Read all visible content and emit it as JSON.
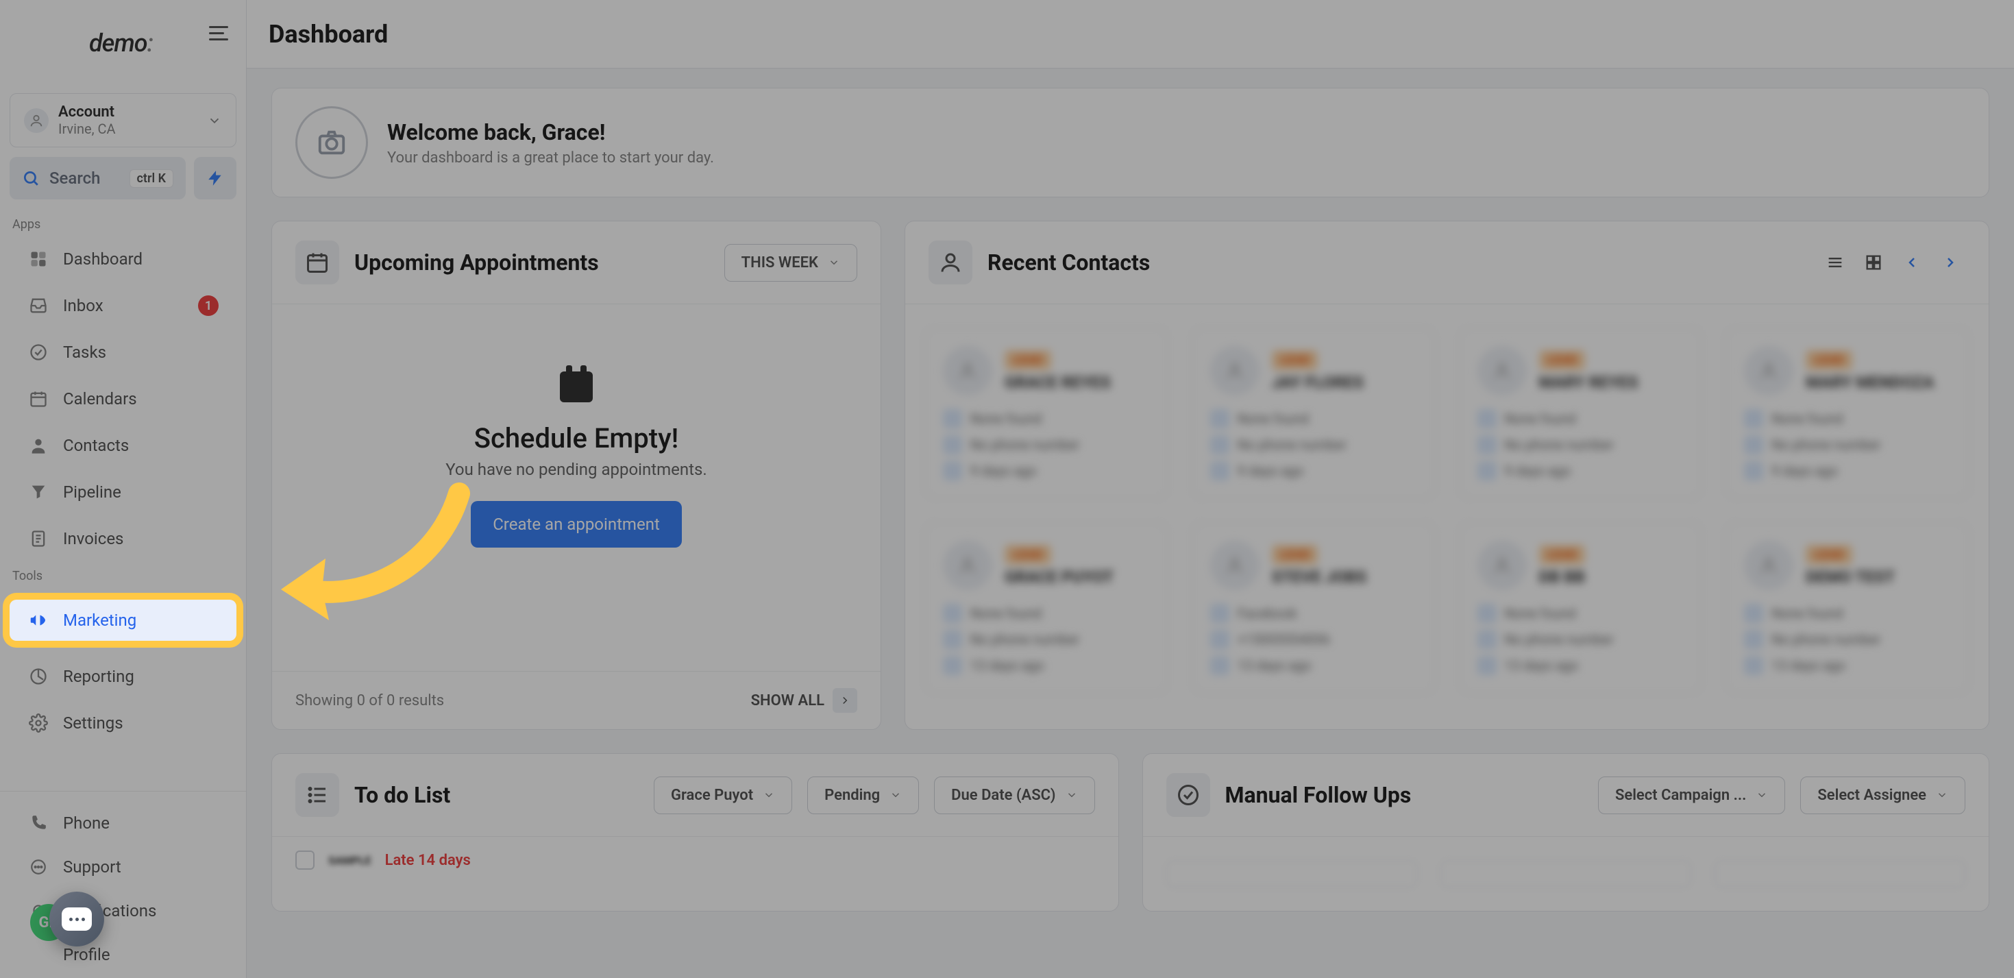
{
  "logo": "demo",
  "account": {
    "title": "Account",
    "sub": "Irvine, CA"
  },
  "search": {
    "placeholder": "Search",
    "kbd": "ctrl K"
  },
  "sections": {
    "apps": "Apps",
    "tools": "Tools"
  },
  "nav": {
    "dashboard": "Dashboard",
    "inbox": "Inbox",
    "inbox_badge": "1",
    "tasks": "Tasks",
    "calendars": "Calendars",
    "contacts": "Contacts",
    "pipeline": "Pipeline",
    "invoices": "Invoices",
    "marketing": "Marketing",
    "reporting": "Reporting",
    "settings": "Settings",
    "phone": "Phone",
    "support": "Support",
    "notifications": "Notifications",
    "profile": "Profile"
  },
  "profile_initials": "GR",
  "topbar": {
    "title": "Dashboard"
  },
  "welcome": {
    "title": "Welcome back, Grace!",
    "sub": "Your dashboard is a great place to start your day."
  },
  "appointments": {
    "title": "Upcoming Appointments",
    "filter": "THIS WEEK",
    "empty_title": "Schedule Empty!",
    "empty_sub": "You have no pending appointments.",
    "create_btn": "Create an appointment",
    "results": "Showing 0 of 0 results",
    "show_all": "SHOW ALL"
  },
  "contacts": {
    "title": "Recent Contacts",
    "cards": [
      [
        {
          "badge": "LEAD",
          "name": "GRACE REYES",
          "email": "None found",
          "phone": "No phone number",
          "time": "9 days ago"
        },
        {
          "badge": "LEAD",
          "name": "JAY FLORES",
          "email": "None found",
          "phone": "No phone number",
          "time": "9 days ago"
        },
        {
          "badge": "LEAD",
          "name": "MARY REYES",
          "email": "None found",
          "phone": "No phone number",
          "time": "9 days ago"
        },
        {
          "badge": "LEAD",
          "name": "MARY MENDOZA",
          "email": "None found",
          "phone": "No phone number",
          "time": "9 days ago"
        }
      ],
      [
        {
          "badge": "LEAD",
          "name": "GRACE PUYOT",
          "email": "None found",
          "phone": "No phone number",
          "time": "13 days ago"
        },
        {
          "badge": "LEAD",
          "name": "STEVE JOBS",
          "email": "Facebook",
          "phone": "+15005554006",
          "time": "13 days ago"
        },
        {
          "badge": "LEAD",
          "name": "DB BB",
          "email": "None found",
          "phone": "No phone number",
          "time": "13 days ago"
        },
        {
          "badge": "LEAD",
          "name": "DEMO TEST",
          "email": "None found",
          "phone": "No phone number",
          "time": "13 days ago"
        }
      ]
    ]
  },
  "todo": {
    "title": "To do List",
    "assignee": "Grace Puyot",
    "status": "Pending",
    "sort": "Due Date (ASC)",
    "item_name": "SAMPLE",
    "item_late": "Late 14 days"
  },
  "followups": {
    "title": "Manual Follow Ups",
    "campaign": "Select Campaign ...",
    "assignee": "Select Assignee"
  }
}
